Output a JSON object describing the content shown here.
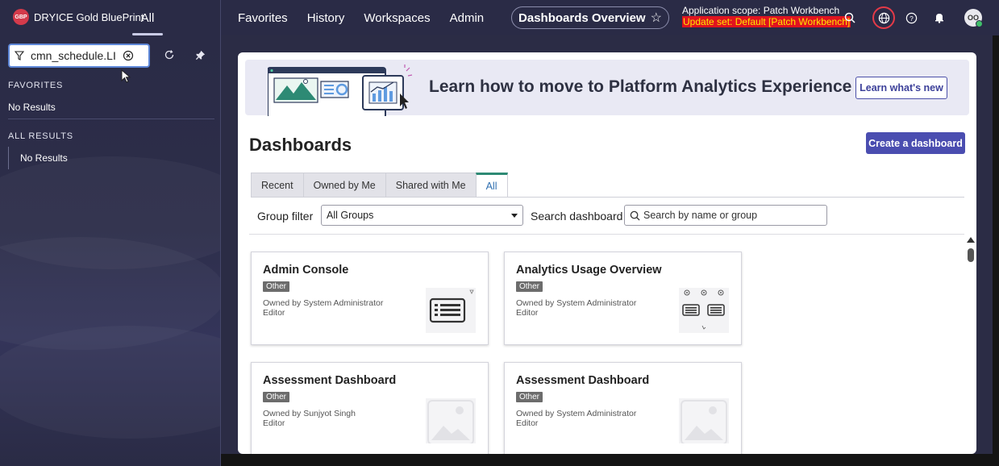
{
  "header": {
    "brand": "DRYICE Gold BluePrint",
    "brand_logo": "GBP",
    "all_tab": "All",
    "menu": [
      "Favorites",
      "History",
      "Workspaces",
      "Admin"
    ],
    "page_pill": "Dashboards Overview",
    "scope_line": "Application scope: Patch Workbench",
    "update_set": "Update set: Default [Patch Workbench]",
    "avatar_initials": "OO",
    "icons": [
      "search-icon",
      "globe-icon",
      "help-icon",
      "bell-icon"
    ]
  },
  "sidebar": {
    "filter_value": "cmn_schedule.LIS",
    "favorites_title": "FAVORITES",
    "favorites_empty": "No Results",
    "all_title": "ALL RESULTS",
    "all_empty": "No Results"
  },
  "banner": {
    "text": "Learn how to move to Platform Analytics Experience",
    "button": "Learn what's new"
  },
  "page": {
    "title": "Dashboards",
    "create_button": "Create a dashboard",
    "tabs": [
      "Recent",
      "Owned by Me",
      "Shared with Me",
      "All"
    ],
    "active_tab": "All",
    "group_filter_label": "Group filter",
    "group_filter_value": "All Groups",
    "search_label": "Search dashboard",
    "search_placeholder": "Search by name or group"
  },
  "cards": [
    {
      "title": "Admin Console",
      "badge": "Other",
      "owner": "Owned by System Administrator",
      "role": "Editor",
      "thumb": "list"
    },
    {
      "title": "Analytics Usage Overview",
      "badge": "Other",
      "owner": "Owned by System Administrator",
      "role": "Editor",
      "thumb": "multi-list"
    },
    {
      "title": "Assessment Dashboard",
      "badge": "Other",
      "owner": "Owned by Sunjyot Singh",
      "role": "Editor",
      "thumb": "image"
    },
    {
      "title": "Assessment Dashboard",
      "badge": "Other",
      "owner": "Owned by System Administrator",
      "role": "Editor",
      "thumb": "image"
    }
  ],
  "colors": {
    "nav_bg": "#2a2b46",
    "accent": "#4a4db0",
    "update_set_bg": "#e0131f",
    "update_set_text": "#ffe600",
    "active_tab_border": "#2e8a74"
  }
}
